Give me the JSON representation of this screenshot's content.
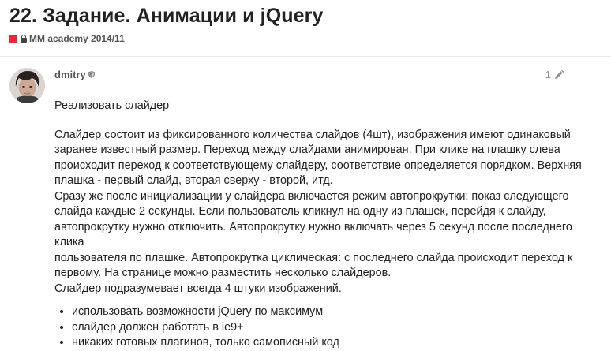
{
  "topic": {
    "title": "22. Задание. Анимации и jQuery",
    "category": "MM academy 2014/11",
    "category_color": "#e9283a"
  },
  "post": {
    "username": "dmitry",
    "post_number": "1",
    "intro": "Реализовать слайдер",
    "paragraph_lines": [
      "Слайдер состоит из фиксированного количества слайдов (4шт), изображения имеют одинаковый",
      "заранее известный размер. Переход между слайдами анимирован. При клике на плашку слева",
      "происходит переход к соответствующему слайдеру, соответствие определяется порядком. Верхняя",
      "плашка - первый слайд, вторая сверху - второй, итд.",
      "Сразу же после инициализации у слайдера включается режим автопрокрутки: показ следующего",
      "слайда каждые 2 секунды. Если пользователь кликнул на одну из плашек, перейдя к слайду,",
      "автопрокрутку нужно отключить. Автопрокрутку нужно включать через 5 секунд после последнего клика",
      "пользователя по плашке. Автопрокрутка циклическая: с последнего слайда происходит переход к",
      "первому. На странице можно разместить несколько слайдеров.",
      "Слайдер подразумевает всегда 4 штуки изображений."
    ],
    "bullets": [
      "использовать возможности jQuery по максимум",
      "слайдер должен работать в ie9+",
      "никаких готовых плагинов, только самописный код"
    ]
  },
  "icons": {
    "lock": "lock-icon",
    "moderator": "shield-icon",
    "edit": "pencil-icon"
  }
}
